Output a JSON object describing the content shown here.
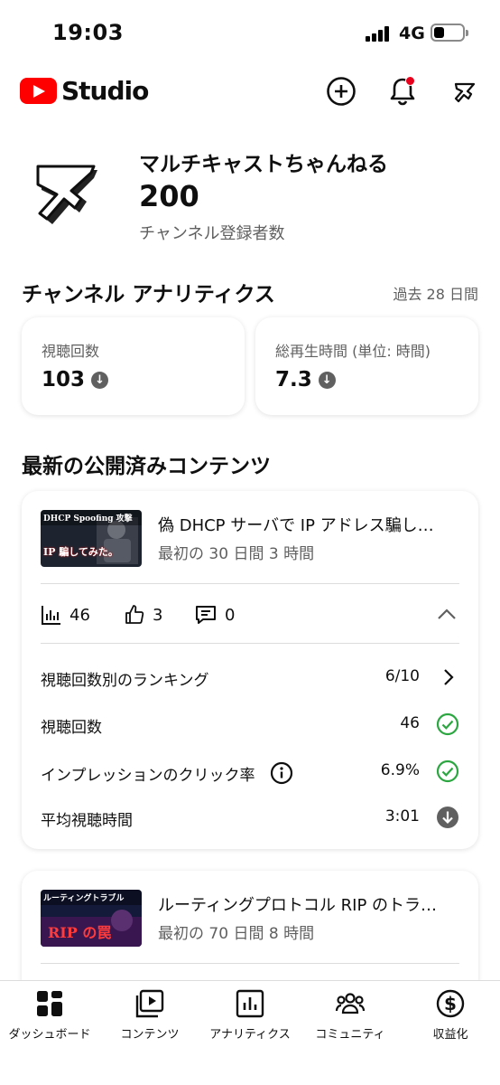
{
  "status_bar": {
    "time": "19:03",
    "network": "4G"
  },
  "header": {
    "app_name": "Studio"
  },
  "channel": {
    "name": "マルチキャストちゃんねる",
    "subscriber_count": "200",
    "subscriber_label": "チャンネル登録者数"
  },
  "analytics": {
    "title": "チャンネル アナリティクス",
    "period": "過去 28 日間",
    "cards": [
      {
        "label": "視聴回数",
        "value": "103"
      },
      {
        "label": "総再生時間 (単位: 時間)",
        "value": "7.3"
      }
    ]
  },
  "latest": {
    "title": "最新の公開済みコンテンツ",
    "videos": [
      {
        "title": "偽 DHCP サーバで IP アドレス騙し…",
        "subtitle": "最初の 30 日間 3 時間",
        "thumbnail_text_top": "DHCP Spoofing 攻撃",
        "thumbnail_text_bottom": "IP 騙してみた。",
        "views": "46",
        "likes": "3",
        "comments": "0",
        "rows": [
          {
            "label": "視聴回数別のランキング",
            "value": "6/10",
            "icon": "chevron-right-icon"
          },
          {
            "label": "視聴回数",
            "value": "46",
            "icon": "check-circle-icon"
          },
          {
            "label": "インプレッションのクリック率",
            "value": "6.9%",
            "icon": "check-circle-icon"
          },
          {
            "label": "平均視聴時間",
            "value": "3:01",
            "icon": "down-circle-icon"
          }
        ]
      },
      {
        "title": "ルーティングプロトコル RIP のトラ…",
        "subtitle": "最初の 70 日間 8 時間",
        "thumbnail_text_top": "ルーティングトラブル",
        "thumbnail_text_bottom": "RIP の罠"
      }
    ]
  },
  "bottom_nav": [
    {
      "label": "ダッシュボード",
      "icon": "dashboard-icon"
    },
    {
      "label": "コンテンツ",
      "icon": "content-icon"
    },
    {
      "label": "アナリティクス",
      "icon": "analytics-icon"
    },
    {
      "label": "コミュニティ",
      "icon": "community-icon"
    },
    {
      "label": "収益化",
      "icon": "monetization-icon"
    }
  ],
  "colors": {
    "brand_red": "#ff0000",
    "success_green": "#2ba640",
    "muted_gray": "#606060"
  }
}
